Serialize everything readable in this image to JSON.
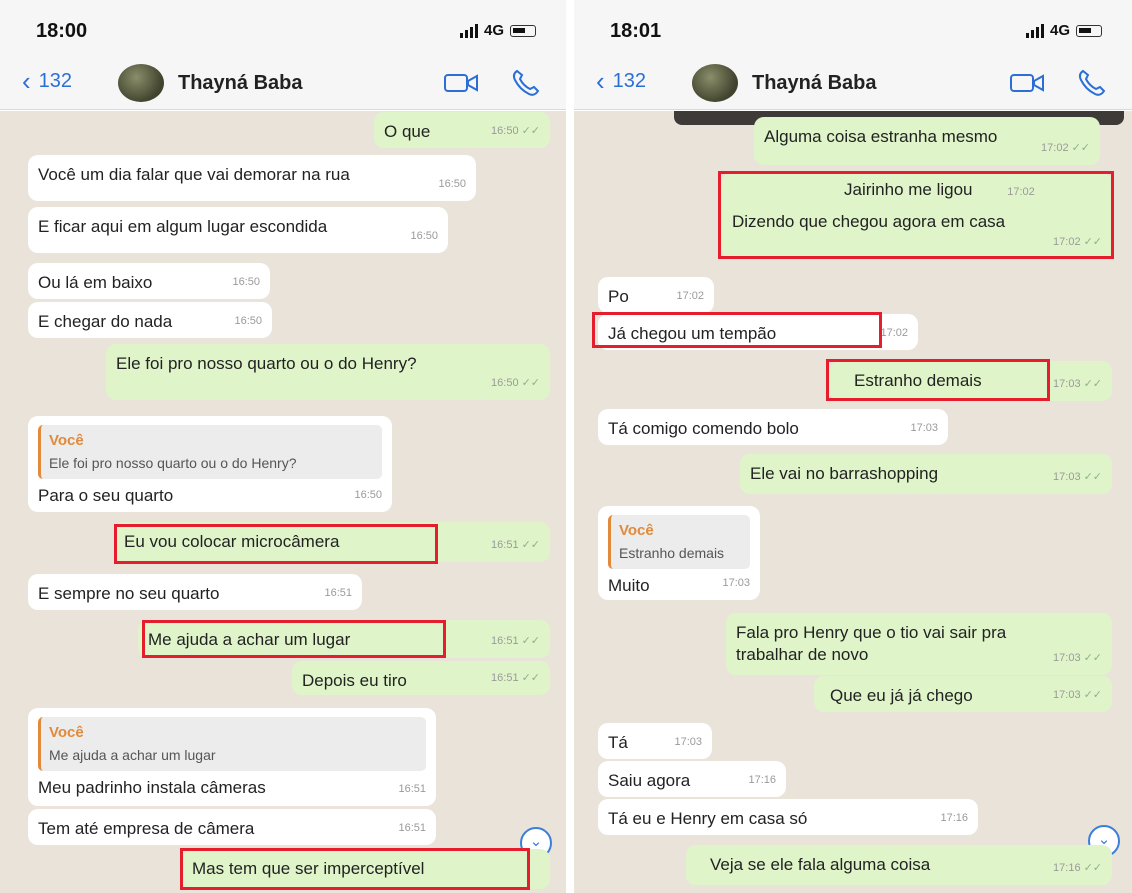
{
  "phone_left": {
    "status_time": "18:00",
    "network": "4G",
    "back_count": "132",
    "contact_name": "Thayná Baba",
    "messages": [
      {
        "text": "O que",
        "time": "16:50"
      },
      {
        "text": "Você um dia falar que vai demorar na rua",
        "time": "16:50"
      },
      {
        "text": "E ficar aqui em algum lugar escondida",
        "time": "16:50"
      },
      {
        "text": "Ou lá em baixo",
        "time": "16:50"
      },
      {
        "text": "E chegar do nada",
        "time": "16:50"
      },
      {
        "text": "Ele foi pro nosso quarto ou o do Henry?",
        "time": "16:50"
      },
      {
        "reply_author": "Você",
        "reply_text": "Ele foi pro nosso quarto ou o do Henry?",
        "text": "Para o seu quarto",
        "time": "16:50"
      },
      {
        "text": "Eu vou colocar microcâmera",
        "time": "16:51"
      },
      {
        "text": "E sempre no seu quarto",
        "time": "16:51"
      },
      {
        "text": "Me ajuda a achar um lugar",
        "time": "16:51"
      },
      {
        "text": "Depois eu tiro",
        "time": "16:51"
      },
      {
        "reply_author": "Você",
        "reply_text": "Me ajuda a achar um lugar",
        "text": "Meu padrinho instala câmeras",
        "time": "16:51"
      },
      {
        "text": "Tem até empresa de câmera",
        "time": "16:51"
      },
      {
        "text": "Mas tem que ser imperceptível"
      }
    ]
  },
  "phone_right": {
    "status_time": "18:01",
    "network": "4G",
    "back_count": "132",
    "contact_name": "Thayná Baba",
    "messages": [
      {
        "text": "Alguma coisa estranha mesmo",
        "time": "17:02"
      },
      {
        "text": "Jairinho me ligou",
        "time": "17:02"
      },
      {
        "text": "Dizendo que chegou agora em casa",
        "time": "17:02"
      },
      {
        "text": "Po",
        "time": "17:02"
      },
      {
        "text": "Já chegou um tempão",
        "time": "17:02"
      },
      {
        "text": "Estranho demais",
        "time": "17:03"
      },
      {
        "text": "Tá comigo comendo bolo",
        "time": "17:03"
      },
      {
        "text": "Ele vai no barrashopping",
        "time": "17:03"
      },
      {
        "reply_author": "Você",
        "reply_text": "Estranho demais",
        "text": "Muito",
        "time": "17:03"
      },
      {
        "text": "Fala pro Henry que o tio vai sair pra trabalhar de novo",
        "time": "17:03"
      },
      {
        "text": "Que eu já já chego",
        "time": "17:03"
      },
      {
        "text": "Tá",
        "time": "17:03"
      },
      {
        "text": "Saiu agora",
        "time": "17:16"
      },
      {
        "text": "Tá eu e Henry em casa só",
        "time": "17:16"
      },
      {
        "text": "Veja se ele fala alguma coisa",
        "time": "17:16"
      }
    ]
  },
  "icons": [
    "chevron-left-icon",
    "video-call-icon",
    "phone-call-icon",
    "scroll-down-icon",
    "read-receipt-icon"
  ],
  "colors": {
    "highlight_box": "#e41e2c",
    "outgoing_bubble": "#dff5c9",
    "incoming_bubble": "#ffffff",
    "accent_blue": "#2b6fd6",
    "reply_author": "#e18a3b"
  }
}
